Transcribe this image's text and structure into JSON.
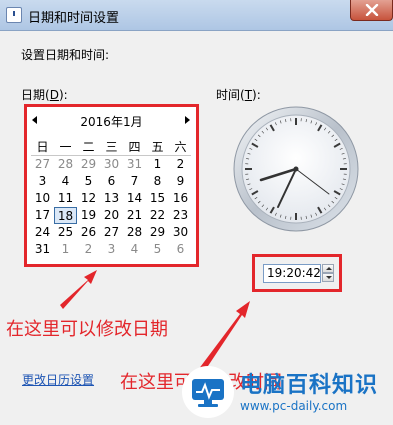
{
  "window": {
    "title": "日期和时间设置"
  },
  "heading": "设置日期和时间:",
  "date_label": {
    "text": "日期(",
    "key": "D",
    "end": "):"
  },
  "time_label": {
    "text": "时间(",
    "key": "T",
    "end": "):"
  },
  "calendar": {
    "month_title": "2016年1月",
    "weekdays": [
      "日",
      "一",
      "二",
      "三",
      "四",
      "五",
      "六"
    ],
    "selected_day": 18,
    "weeks": [
      [
        {
          "d": "27",
          "o": true
        },
        {
          "d": "28",
          "o": true
        },
        {
          "d": "29",
          "o": true
        },
        {
          "d": "30",
          "o": true
        },
        {
          "d": "31",
          "o": true
        },
        {
          "d": "1"
        },
        {
          "d": "2"
        }
      ],
      [
        {
          "d": "3"
        },
        {
          "d": "4"
        },
        {
          "d": "5"
        },
        {
          "d": "6"
        },
        {
          "d": "7"
        },
        {
          "d": "8"
        },
        {
          "d": "9"
        }
      ],
      [
        {
          "d": "10"
        },
        {
          "d": "11"
        },
        {
          "d": "12"
        },
        {
          "d": "13"
        },
        {
          "d": "14"
        },
        {
          "d": "15"
        },
        {
          "d": "16"
        }
      ],
      [
        {
          "d": "17"
        },
        {
          "d": "18"
        },
        {
          "d": "19"
        },
        {
          "d": "20"
        },
        {
          "d": "21"
        },
        {
          "d": "22"
        },
        {
          "d": "23"
        }
      ],
      [
        {
          "d": "24"
        },
        {
          "d": "25"
        },
        {
          "d": "26"
        },
        {
          "d": "27"
        },
        {
          "d": "28"
        },
        {
          "d": "29"
        },
        {
          "d": "30"
        }
      ],
      [
        {
          "d": "31"
        },
        {
          "d": "1",
          "o": true
        },
        {
          "d": "2",
          "o": true
        },
        {
          "d": "3",
          "o": true
        },
        {
          "d": "4",
          "o": true
        },
        {
          "d": "5",
          "o": true
        },
        {
          "d": "6",
          "o": true
        }
      ]
    ]
  },
  "time": {
    "value": "19:20:42"
  },
  "annotations": {
    "date_hint": "在这里可以修改日期",
    "time_hint": "在这里可以修改时间"
  },
  "link": {
    "change_calendar": "更改日历设置"
  },
  "watermark": {
    "name": "电脑百科知识",
    "url": "www.pc-daily.com"
  },
  "colors": {
    "annotation_red": "#e3262b",
    "link_blue": "#1e55b3",
    "watermark_blue": "#1a73c5"
  },
  "icons": [
    "clock-icon",
    "close-icon",
    "prev-month-icon",
    "next-month-icon",
    "spin-up-icon",
    "spin-down-icon",
    "monitor-logo-icon"
  ]
}
